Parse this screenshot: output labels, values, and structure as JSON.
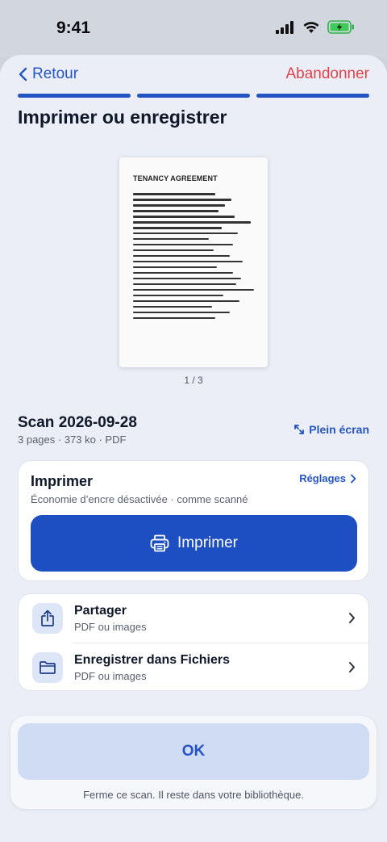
{
  "status_bar": {
    "time": "9:41"
  },
  "nav": {
    "back_label": "Retour",
    "abandon_label": "Abandonner"
  },
  "progress": {
    "steps_total": 3,
    "steps_completed": 3
  },
  "page_title": "Imprimer ou enregistrer",
  "preview": {
    "doc_heading": "TENANCY AGREEMENT",
    "page_counter": "1 / 3"
  },
  "scan": {
    "name": "Scan 2026-09-28",
    "meta": "3 pages · 373 ko · PDF",
    "fullscreen_label": "Plein écran"
  },
  "print_card": {
    "title": "Imprimer",
    "subtitle": "Économie d’encre désactivée · comme scanné",
    "settings_label": "Réglages",
    "button_label": "Imprimer"
  },
  "actions": [
    {
      "title": "Partager",
      "subtitle": "PDF ou images",
      "icon": "share-icon"
    },
    {
      "title": "Enregistrer dans Fichiers",
      "subtitle": "PDF ou images",
      "icon": "folder-icon"
    }
  ],
  "footer": {
    "ok_label": "OK",
    "hint": "Ferme ce scan. Il reste dans votre bibliothèque."
  },
  "colors": {
    "accent": "#1e4fc2",
    "destructive": "#e2434b",
    "background": "#ebeef6"
  }
}
